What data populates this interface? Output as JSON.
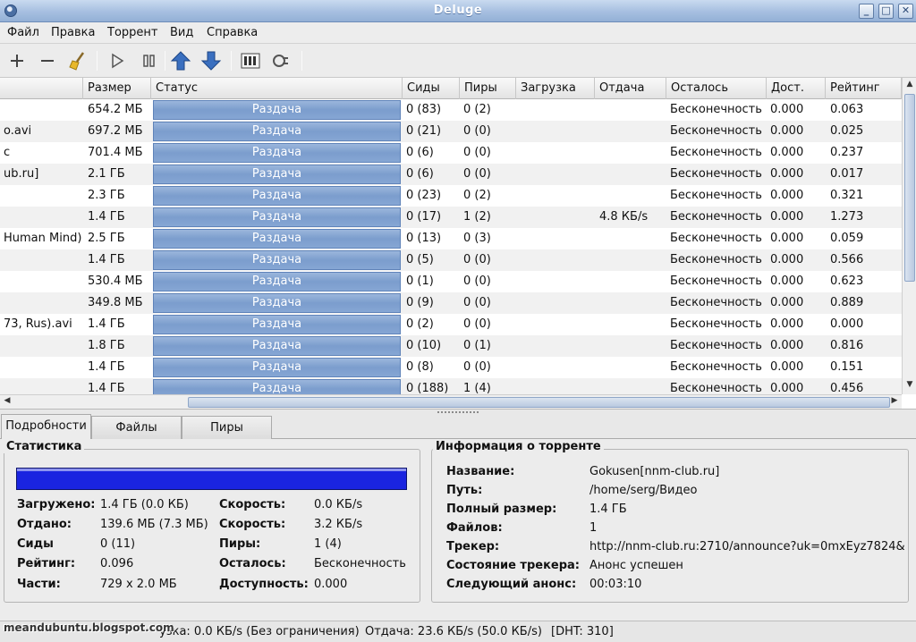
{
  "window": {
    "title": "Deluge",
    "minimize_label": "_",
    "maximize_label": "□",
    "close_label": "✕"
  },
  "menu": [
    "Файл",
    "Правка",
    "Торрент",
    "Вид",
    "Справка"
  ],
  "toolbar": {
    "buttons": [
      "add-icon",
      "remove-icon",
      "clear-icon",
      "resume-icon",
      "pause-icon",
      "queue-up-icon",
      "queue-down-icon",
      "preferences-icon",
      "connection-manager-icon"
    ]
  },
  "list": {
    "headers": [
      "Размер",
      "Статус",
      "Сиды",
      "Пиры",
      "Загрузка",
      "Отдача",
      "Осталось",
      "Дост.",
      "Рейтинг"
    ],
    "rows": [
      {
        "name": "",
        "size": "654.2 МБ",
        "status": "Раздача",
        "progress": 1.0,
        "seeds": "0 (83)",
        "peers": "0 (2)",
        "down": "",
        "up": "",
        "eta": "Бесконечность",
        "avail": "0.000",
        "ratio": "0.063"
      },
      {
        "name": "o.avi",
        "size": "697.2 МБ",
        "status": "Раздача",
        "progress": 1.0,
        "seeds": "0 (21)",
        "peers": "0 (0)",
        "down": "",
        "up": "",
        "eta": "Бесконечность",
        "avail": "0.000",
        "ratio": "0.025"
      },
      {
        "name": "c",
        "size": "701.4 МБ",
        "status": "Раздача",
        "progress": 1.0,
        "seeds": "0 (6)",
        "peers": "0 (0)",
        "down": "",
        "up": "",
        "eta": "Бесконечность",
        "avail": "0.000",
        "ratio": "0.237"
      },
      {
        "name": "ub.ru]",
        "size": "2.1 ГБ",
        "status": "Раздача",
        "progress": 1.0,
        "seeds": "0 (6)",
        "peers": "0 (0)",
        "down": "",
        "up": "",
        "eta": "Бесконечность",
        "avail": "0.000",
        "ratio": "0.017"
      },
      {
        "name": "",
        "size": "2.3 ГБ",
        "status": "Раздача",
        "progress": 1.0,
        "seeds": "0 (23)",
        "peers": "0 (2)",
        "down": "",
        "up": "",
        "eta": "Бесконечность",
        "avail": "0.000",
        "ratio": "0.321"
      },
      {
        "name": "",
        "size": "1.4 ГБ",
        "status": "Раздача",
        "progress": 1.0,
        "seeds": "0 (17)",
        "peers": "1 (2)",
        "down": "",
        "up": "4.8 КБ/s",
        "eta": "Бесконечность",
        "avail": "0.000",
        "ratio": "1.273"
      },
      {
        "name": "Human Mind)",
        "size": "2.5 ГБ",
        "status": "Раздача",
        "progress": 1.0,
        "seeds": "0 (13)",
        "peers": "0 (3)",
        "down": "",
        "up": "",
        "eta": "Бесконечность",
        "avail": "0.000",
        "ratio": "0.059"
      },
      {
        "name": "",
        "size": "1.4 ГБ",
        "status": "Раздача",
        "progress": 1.0,
        "seeds": "0 (5)",
        "peers": "0 (0)",
        "down": "",
        "up": "",
        "eta": "Бесконечность",
        "avail": "0.000",
        "ratio": "0.566"
      },
      {
        "name": "",
        "size": "530.4 МБ",
        "status": "Раздача",
        "progress": 1.0,
        "seeds": "0 (1)",
        "peers": "0 (0)",
        "down": "",
        "up": "",
        "eta": "Бесконечность",
        "avail": "0.000",
        "ratio": "0.623"
      },
      {
        "name": "",
        "size": "349.8 МБ",
        "status": "Раздача",
        "progress": 1.0,
        "seeds": "0 (9)",
        "peers": "0 (0)",
        "down": "",
        "up": "",
        "eta": "Бесконечность",
        "avail": "0.000",
        "ratio": "0.889"
      },
      {
        "name": "73, Rus).avi",
        "size": "1.4 ГБ",
        "status": "Раздача",
        "progress": 1.0,
        "seeds": "0 (2)",
        "peers": "0 (0)",
        "down": "",
        "up": "",
        "eta": "Бесконечность",
        "avail": "0.000",
        "ratio": "0.000"
      },
      {
        "name": "",
        "size": "1.8 ГБ",
        "status": "Раздача",
        "progress": 1.0,
        "seeds": "0 (10)",
        "peers": "0 (1)",
        "down": "",
        "up": "",
        "eta": "Бесконечность",
        "avail": "0.000",
        "ratio": "0.816"
      },
      {
        "name": "",
        "size": "1.4 ГБ",
        "status": "Раздача",
        "progress": 1.0,
        "seeds": "0 (8)",
        "peers": "0 (0)",
        "down": "",
        "up": "",
        "eta": "Бесконечность",
        "avail": "0.000",
        "ratio": "0.151"
      },
      {
        "name": "",
        "size": "1.4 ГБ",
        "status": "Раздача",
        "progress": 1.0,
        "seeds": "0 (188)",
        "peers": "1 (4)",
        "down": "",
        "up": "",
        "eta": "Бесконечность",
        "avail": "0.000",
        "ratio": "0.456"
      }
    ]
  },
  "tabs": [
    "Подробности",
    "Файлы",
    "Пиры"
  ],
  "stats": {
    "title": "Статистика",
    "progress": 1.0,
    "downloaded_label": "Загружено:",
    "downloaded": "1.4 ГБ (0.0 КБ)",
    "uploaded_label": "Отдано:",
    "uploaded": "139.6 МБ (7.3 МБ)",
    "seeds_label": "Сиды",
    "seeds": "0 (11)",
    "ratio_label": "Рейтинг:",
    "ratio": "0.096",
    "pieces_label": "Части:",
    "pieces": "729 x 2.0 МБ",
    "down_speed_label": "Скорость:",
    "down_speed": "0.0 КБ/s",
    "up_speed_label": "Скорость:",
    "up_speed": "3.2 КБ/s",
    "peers_label": "Пиры:",
    "peers": "1 (4)",
    "eta_label": "Осталось:",
    "eta": "Бесконечность",
    "availability_label": "Доступность:",
    "availability": "0.000"
  },
  "info": {
    "title": "Информация о торренте",
    "name_label": "Название:",
    "name": "Gokusen[nnm-club.ru]",
    "path_label": "Путь:",
    "path": "/home/serg/Видео",
    "size_label": "Полный размер:",
    "size": "1.4 ГБ",
    "files_label": "Файлов:",
    "files": "1",
    "tracker_label": "Трекер:",
    "tracker": "http://nnm-club.ru:2710/announce?uk=0mxEyz7824&",
    "tracker_status_label": "Состояние трекера:",
    "tracker_status": "Анонс успешен",
    "next_announce_label": "Следующий анонс:",
    "next_announce": "00:03:10"
  },
  "statusbar": {
    "download": "узка: 0.0 КБ/s (Без ограничения)",
    "upload": "Отдача: 23.6 КБ/s (50.0 КБ/s)",
    "dht": "[DHT: 310]"
  },
  "watermark": "meandubuntu.blogspot.com"
}
